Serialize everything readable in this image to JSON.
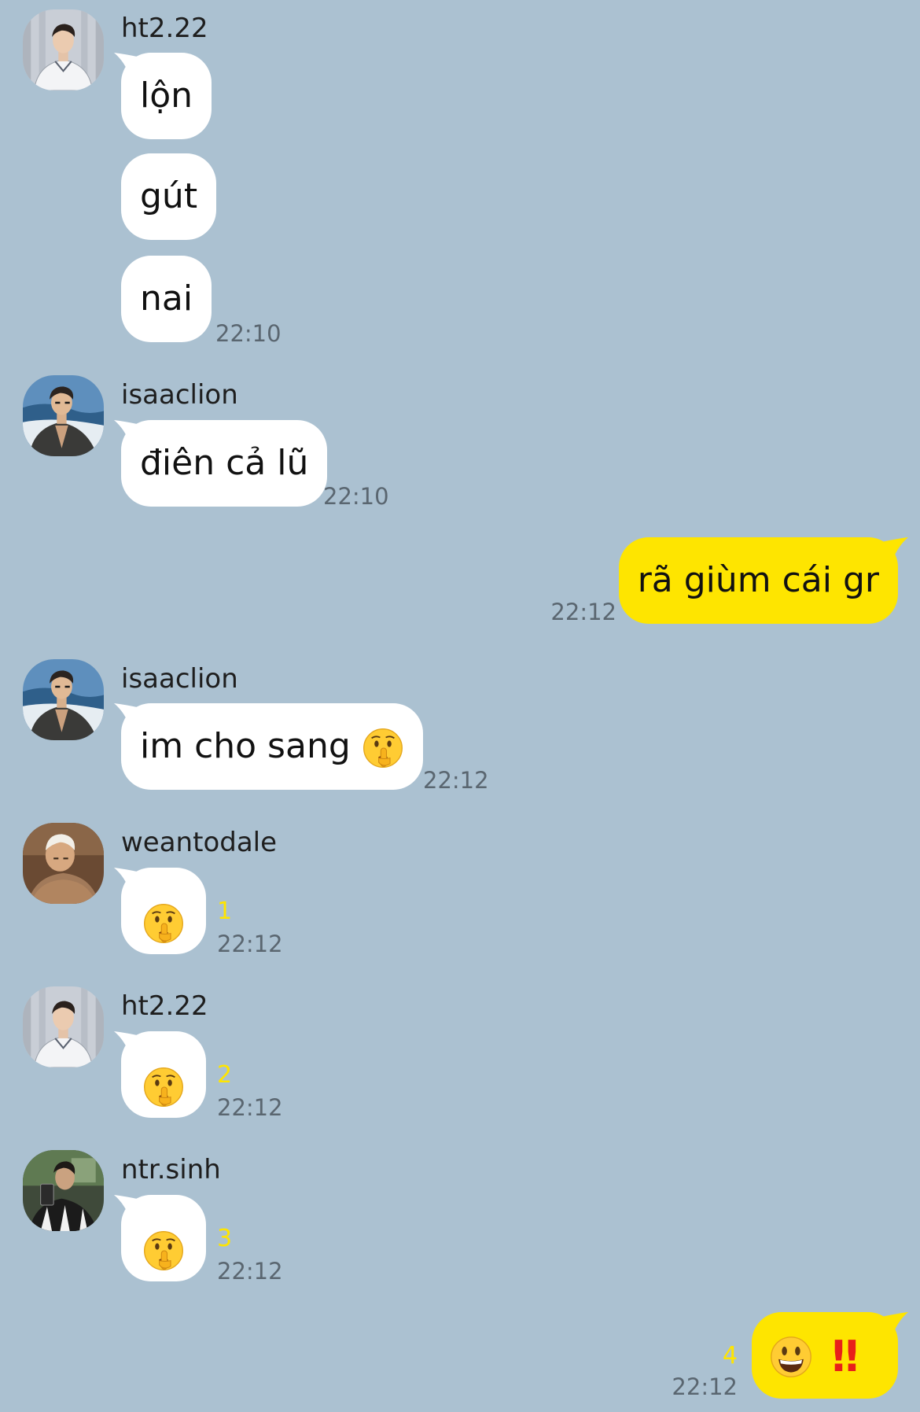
{
  "colors": {
    "background": "#abc1d1",
    "incoming_bubble": "#ffffff",
    "outgoing_bubble": "#fee500",
    "unread_count": "#ffe500",
    "timestamp": "#5a6670",
    "bang": "#e8201a"
  },
  "icons": {
    "shush": "shushing-face-icon",
    "grin": "grinning-face-icon",
    "bang": "double-exclamation-icon"
  },
  "messages": [
    {
      "sender": "ht2.22",
      "texts": [
        "lộn",
        "gút",
        "nai"
      ],
      "time": "22:10"
    },
    {
      "sender": "isaaclion",
      "text": "điên cả lũ",
      "time": "22:10"
    },
    {
      "outgoing": true,
      "text": "rã giùm cái gr",
      "time": "22:12"
    },
    {
      "sender": "isaaclion",
      "text": "im cho sang",
      "time": "22:12"
    },
    {
      "sender": "weantodale",
      "unread": "1",
      "time": "22:12"
    },
    {
      "sender": "ht2.22",
      "unread": "2",
      "time": "22:12"
    },
    {
      "sender": "ntr.sinh",
      "unread": "3",
      "time": "22:12"
    },
    {
      "outgoing": true,
      "bang_text": "‼",
      "unread": "4",
      "time": "22:12"
    }
  ]
}
